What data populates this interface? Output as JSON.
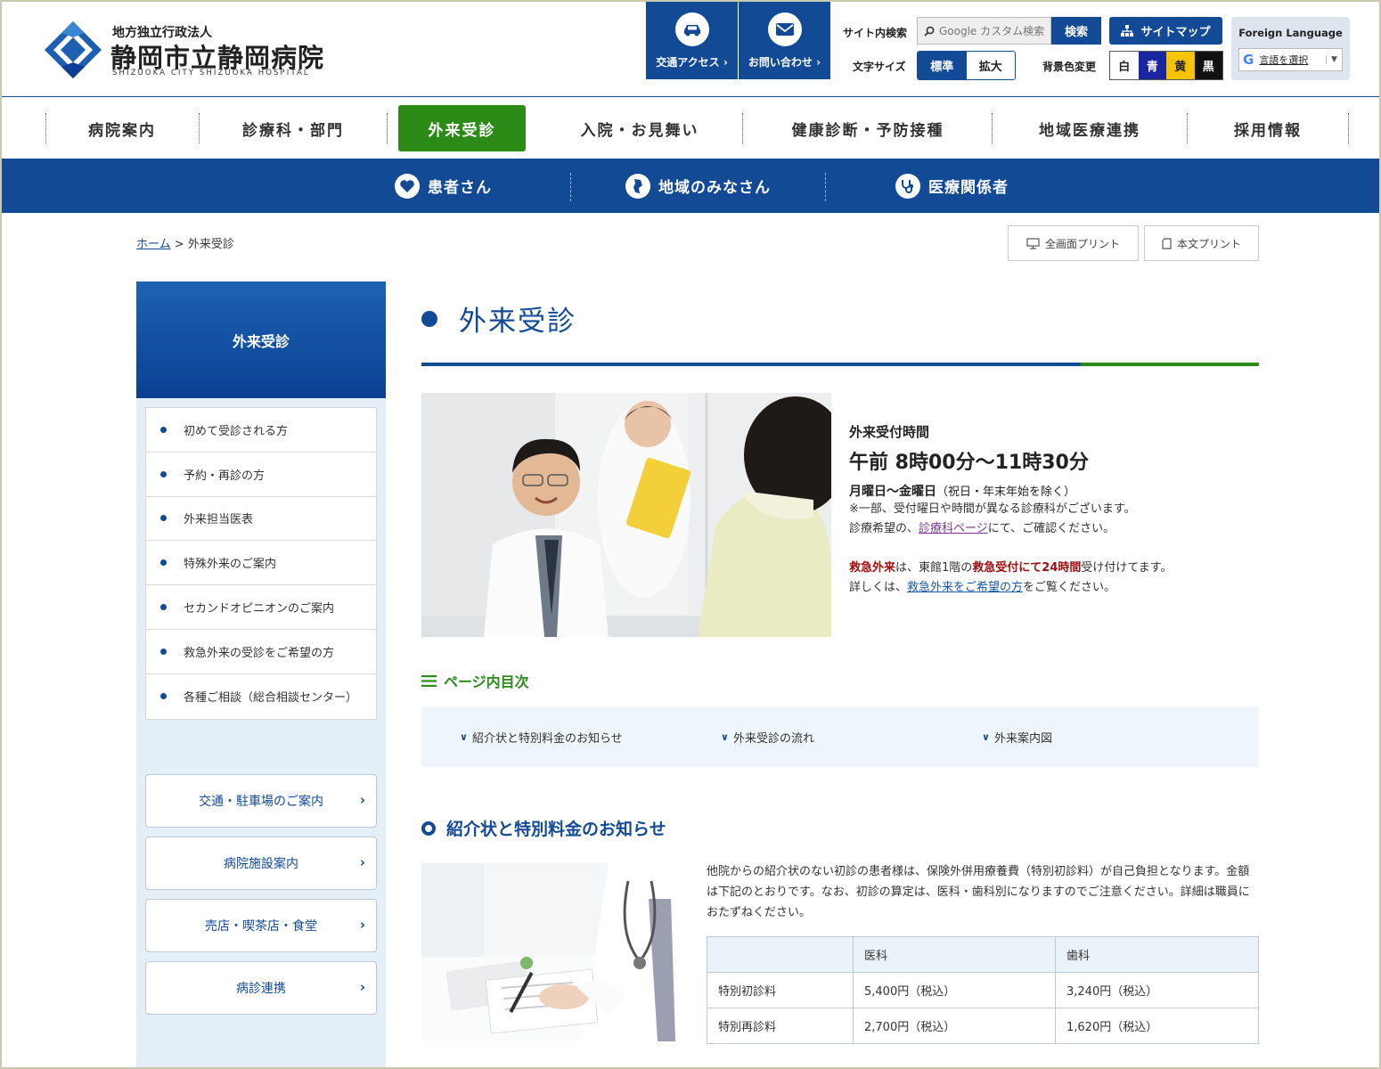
{
  "header": {
    "org_sub": "地方独立行政法人",
    "org_name": "静岡市立静岡病院",
    "org_en": "SHIZUOKA CITY SHIZUOKA HOSPITAL",
    "access_label": "交通アクセス",
    "contact_label": "お問い合わせ",
    "search_label": "サイト内検索",
    "search_placeholder": "Google カスタム検索",
    "search_button": "検索",
    "sitemap_label": "サイトマップ",
    "fontsize_label": "文字サイズ",
    "fontsize_options": [
      "標準",
      "拡大"
    ],
    "bgcolor_label": "背景色変更",
    "bgcolor_options": [
      {
        "label": "白",
        "bg": "#ffffff",
        "fg": "#222222"
      },
      {
        "label": "青",
        "bg": "#1a25a0",
        "fg": "#ffffff"
      },
      {
        "label": "黄",
        "bg": "#f5c400",
        "fg": "#222222"
      },
      {
        "label": "黒",
        "bg": "#111111",
        "fg": "#ffffff"
      }
    ],
    "foreign_title": "Foreign Language",
    "translate_select": "言語を選択"
  },
  "gnav": {
    "items": [
      "病院案内",
      "診療科・部門",
      "外来受診",
      "入院・お見舞い",
      "健康診断・予防接種",
      "地域医療連携",
      "採用情報"
    ],
    "active": "外来受診"
  },
  "subnav": {
    "items": [
      "患者さん",
      "地域のみなさん",
      "医療関係者"
    ]
  },
  "breadcrumb": {
    "home": "ホーム",
    "separator": ">",
    "current": "外来受診"
  },
  "print": {
    "full": "全画面プリント",
    "body": "本文プリント"
  },
  "sidebar": {
    "title": "外来受診",
    "items": [
      "初めて受診される方",
      "予約・再診の方",
      "外来担当医表",
      "特殊外来のご案内",
      "セカンドオピニオンのご案内",
      "救急外来の受診をご希望の方",
      "各種ご相談（総合相談センター）"
    ],
    "buttons": [
      "交通・駐車場のご案内",
      "病院施設案内",
      "売店・喫茶店・食堂",
      "病診連携"
    ]
  },
  "main": {
    "title": "外来受診",
    "hours_label": "外来受付時間",
    "hours_time": "午前 8時00分～11時30分",
    "hours_days": "月曜日～金曜日",
    "hours_days_note": "（祝日・年末年始を除く）",
    "note1": "※一部、受付曜日や時間が異なる診療科がございます。",
    "note2_pre": "診療希望の、",
    "note2_link": "診療科ページ",
    "note2_post": "にて、ご確認ください。",
    "er_a": "救急外来",
    "er_b": "は、東館1階の",
    "er_c": "救急受付にて24時間",
    "er_d": "受け付けてます。",
    "er2_pre": "詳しくは、",
    "er2_link": "救急外来をご希望の方",
    "er2_post": "をご覧ください。",
    "toc_title": "ページ内目次",
    "toc_items": [
      "紹介状と特別料金のお知らせ",
      "外来受診の流れ",
      "外来案内図"
    ],
    "section_title": "紹介状と特別料金のお知らせ",
    "section_text": "他院からの紹介状のない初診の患者様は、保険外併用療養費（特別初診料）が自己負担となります。金額は下記のとおりです。なお、初診の算定は、医科・歯科別になりますのでご注意ください。詳細は職員におたずねください。",
    "table": {
      "headers": [
        "",
        "医科",
        "歯科"
      ],
      "rows": [
        [
          "特別初診料",
          "5,400円（税込）",
          "3,240円（税込）"
        ],
        [
          "特別再診料",
          "2,700円（税込）",
          "1,620円（税込）"
        ]
      ]
    }
  },
  "colors": {
    "primary": "#124a96",
    "accent_green": "#2c8a17",
    "emergency_red": "#a01010"
  }
}
